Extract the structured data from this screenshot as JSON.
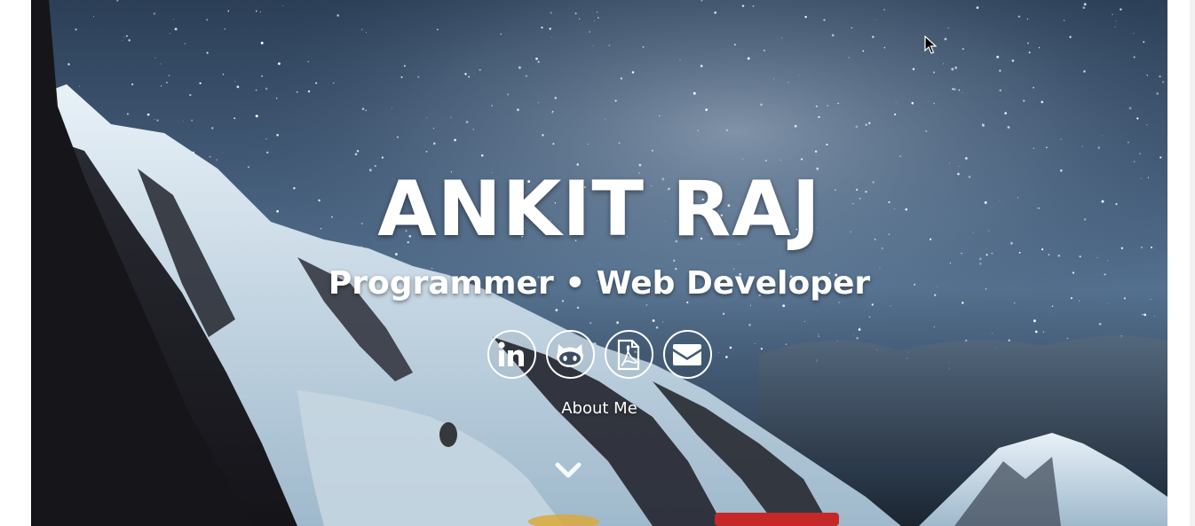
{
  "hero": {
    "name": "ANKIT RAJ",
    "tagline": "Programmer • Web Developer",
    "social_links": [
      {
        "icon": "linkedin-icon"
      },
      {
        "icon": "github-icon"
      },
      {
        "icon": "pdf-resume-icon"
      },
      {
        "icon": "email-icon"
      }
    ],
    "about_link": "About Me",
    "scroll_icon": "chevron-down-icon"
  },
  "colors": {
    "text": "#ffffff",
    "page_background": "#ffffff",
    "sky": "#3f5672"
  }
}
